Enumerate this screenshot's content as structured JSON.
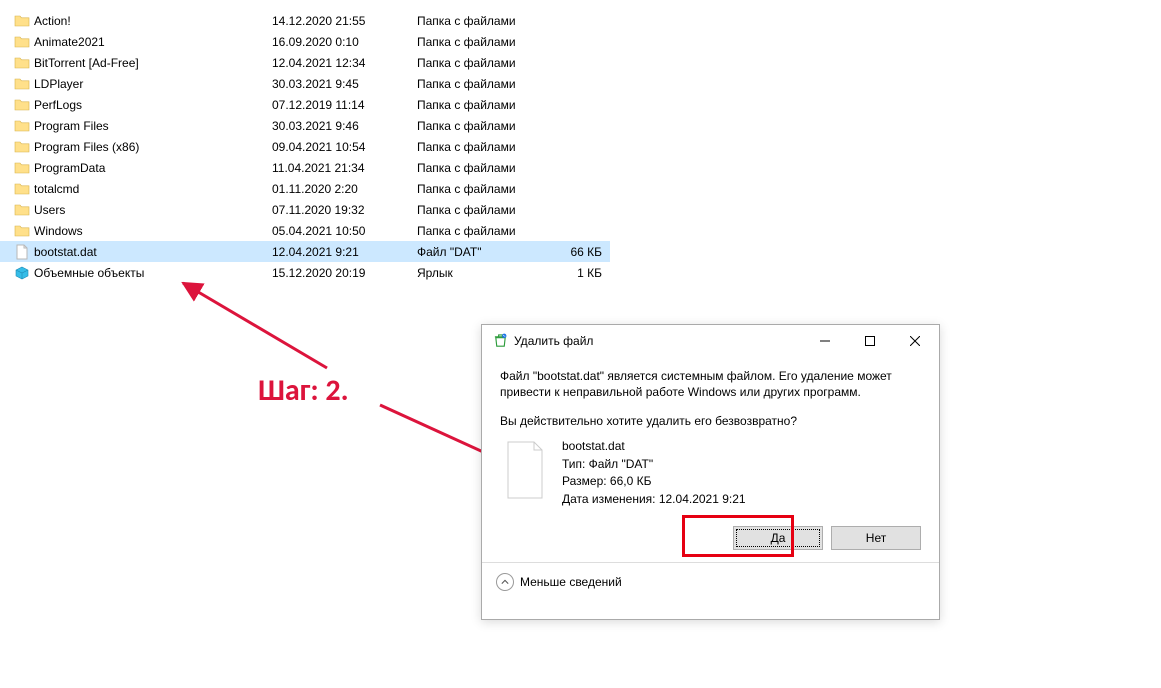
{
  "files": [
    {
      "name": "Action!",
      "date": "14.12.2020 21:55",
      "type": "Папка с файлами",
      "size": "",
      "icon": "folder"
    },
    {
      "name": "Animate2021",
      "date": "16.09.2020 0:10",
      "type": "Папка с файлами",
      "size": "",
      "icon": "folder"
    },
    {
      "name": "BitTorrent [Ad-Free]",
      "date": "12.04.2021 12:34",
      "type": "Папка с файлами",
      "size": "",
      "icon": "folder"
    },
    {
      "name": "LDPlayer",
      "date": "30.03.2021 9:45",
      "type": "Папка с файлами",
      "size": "",
      "icon": "folder"
    },
    {
      "name": "PerfLogs",
      "date": "07.12.2019 11:14",
      "type": "Папка с файлами",
      "size": "",
      "icon": "folder"
    },
    {
      "name": "Program Files",
      "date": "30.03.2021 9:46",
      "type": "Папка с файлами",
      "size": "",
      "icon": "folder"
    },
    {
      "name": "Program Files (x86)",
      "date": "09.04.2021 10:54",
      "type": "Папка с файлами",
      "size": "",
      "icon": "folder"
    },
    {
      "name": "ProgramData",
      "date": "11.04.2021 21:34",
      "type": "Папка с файлами",
      "size": "",
      "icon": "folder"
    },
    {
      "name": "totalcmd",
      "date": "01.11.2020 2:20",
      "type": "Папка с файлами",
      "size": "",
      "icon": "folder"
    },
    {
      "name": "Users",
      "date": "07.11.2020 19:32",
      "type": "Папка с файлами",
      "size": "",
      "icon": "folder"
    },
    {
      "name": "Windows",
      "date": "05.04.2021 10:50",
      "type": "Папка с файлами",
      "size": "",
      "icon": "folder"
    },
    {
      "name": "bootstat.dat",
      "date": "12.04.2021 9:21",
      "type": "Файл \"DAT\"",
      "size": "66 КБ",
      "icon": "file",
      "selected": true
    },
    {
      "name": "Объемные объекты",
      "date": "15.12.2020 20:19",
      "type": "Ярлык",
      "size": "1 КБ",
      "icon": "3dobjects"
    }
  ],
  "annotation": {
    "step_label": "Шаг: 2."
  },
  "dialog": {
    "title": "Удалить файл",
    "warning": "Файл \"bootstat.dat\" является системным файлом. Его удаление может привести к неправильной работе Windows или других программ.",
    "confirm": "Вы действительно хотите удалить его безвозвратно?",
    "details": {
      "name": "bootstat.dat",
      "type_line": "Тип: Файл \"DAT\"",
      "size_line": "Размер: 66,0 КБ",
      "date_line": "Дата изменения: 12.04.2021 9:21"
    },
    "buttons": {
      "yes": "Да",
      "no": "Нет"
    },
    "less_details": "Меньше сведений"
  }
}
